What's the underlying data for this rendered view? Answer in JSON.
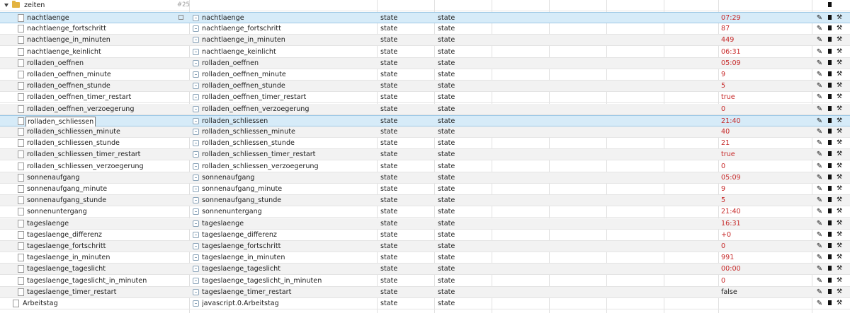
{
  "folder": {
    "name": "zeiten",
    "count": "#25"
  },
  "rows": [
    {
      "name": "nachtlaenge",
      "alias": "nachtlaenge",
      "type": "state",
      "role": "state",
      "value": "07:29",
      "vstyle": "red",
      "sel": true,
      "copy": true
    },
    {
      "name": "nachtlaenge_fortschritt",
      "alias": "nachtlaenge_fortschritt",
      "type": "state",
      "role": "state",
      "value": "87",
      "vstyle": "red"
    },
    {
      "name": "nachtlaenge_in_minuten",
      "alias": "nachtlaenge_in_minuten",
      "type": "state",
      "role": "state",
      "value": "449",
      "vstyle": "red"
    },
    {
      "name": "nachtlaenge_keinlicht",
      "alias": "nachtlaenge_keinlicht",
      "type": "state",
      "role": "state",
      "value": "06:31",
      "vstyle": "red"
    },
    {
      "name": "rolladen_oeffnen",
      "alias": "rolladen_oeffnen",
      "type": "state",
      "role": "state",
      "value": "05:09",
      "vstyle": "red"
    },
    {
      "name": "rolladen_oeffnen_minute",
      "alias": "rolladen_oeffnen_minute",
      "type": "state",
      "role": "state",
      "value": "9",
      "vstyle": "red"
    },
    {
      "name": "rolladen_oeffnen_stunde",
      "alias": "rolladen_oeffnen_stunde",
      "type": "state",
      "role": "state",
      "value": "5",
      "vstyle": "red"
    },
    {
      "name": "rolladen_oeffnen_timer_restart",
      "alias": "rolladen_oeffnen_timer_restart",
      "type": "state",
      "role": "state",
      "value": "true",
      "vstyle": "red"
    },
    {
      "name": "rolladen_oeffnen_verzoegerung",
      "alias": "rolladen_oeffnen_verzoegerung",
      "type": "state",
      "role": "state",
      "value": "0",
      "vstyle": "red"
    },
    {
      "name": "rolladen_schliessen",
      "alias": "rolladen_schliessen",
      "type": "state",
      "role": "state",
      "value": "21:40",
      "vstyle": "red",
      "sel": true,
      "box": true
    },
    {
      "name": "rolladen_schliessen_minute",
      "alias": "rolladen_schliessen_minute",
      "type": "state",
      "role": "state",
      "value": "40",
      "vstyle": "red"
    },
    {
      "name": "rolladen_schliessen_stunde",
      "alias": "rolladen_schliessen_stunde",
      "type": "state",
      "role": "state",
      "value": "21",
      "vstyle": "red"
    },
    {
      "name": "rolladen_schliessen_timer_restart",
      "alias": "rolladen_schliessen_timer_restart",
      "type": "state",
      "role": "state",
      "value": "true",
      "vstyle": "red"
    },
    {
      "name": "rolladen_schliessen_verzoegerung",
      "alias": "rolladen_schliessen_verzoegerung",
      "type": "state",
      "role": "state",
      "value": "0",
      "vstyle": "red"
    },
    {
      "name": "sonnenaufgang",
      "alias": "sonnenaufgang",
      "type": "state",
      "role": "state",
      "value": "05:09",
      "vstyle": "red"
    },
    {
      "name": "sonnenaufgang_minute",
      "alias": "sonnenaufgang_minute",
      "type": "state",
      "role": "state",
      "value": "9",
      "vstyle": "red"
    },
    {
      "name": "sonnenaufgang_stunde",
      "alias": "sonnenaufgang_stunde",
      "type": "state",
      "role": "state",
      "value": "5",
      "vstyle": "red"
    },
    {
      "name": "sonnenuntergang",
      "alias": "sonnenuntergang",
      "type": "state",
      "role": "state",
      "value": "21:40",
      "vstyle": "red"
    },
    {
      "name": "tageslaenge",
      "alias": "tageslaenge",
      "type": "state",
      "role": "state",
      "value": "16:31",
      "vstyle": "red"
    },
    {
      "name": "tageslaenge_differenz",
      "alias": "tageslaenge_differenz",
      "type": "state",
      "role": "state",
      "value": "+0",
      "vstyle": "red"
    },
    {
      "name": "tageslaenge_fortschritt",
      "alias": "tageslaenge_fortschritt",
      "type": "state",
      "role": "state",
      "value": "0",
      "vstyle": "red"
    },
    {
      "name": "tageslaenge_in_minuten",
      "alias": "tageslaenge_in_minuten",
      "type": "state",
      "role": "state",
      "value": "991",
      "vstyle": "red"
    },
    {
      "name": "tageslaenge_tageslicht",
      "alias": "tageslaenge_tageslicht",
      "type": "state",
      "role": "state",
      "value": "00:00",
      "vstyle": "red"
    },
    {
      "name": "tageslaenge_tageslicht_in_minuten",
      "alias": "tageslaenge_tageslicht_in_minuten",
      "type": "state",
      "role": "state",
      "value": "0",
      "vstyle": "red"
    },
    {
      "name": "tageslaenge_timer_restart",
      "alias": "tageslaenge_timer_restart",
      "type": "state",
      "role": "state",
      "value": "false",
      "vstyle": "plain"
    },
    {
      "name": "Arbeitstag",
      "alias": "javascript.0.Arbeitstag",
      "type": "state",
      "role": "state",
      "value": "",
      "vstyle": "plain",
      "top": true
    }
  ],
  "icons": {
    "edit": "pencil-icon",
    "delete": "trash-icon",
    "settings": "wrench-icon",
    "folder": "folder-icon",
    "file": "file-icon",
    "alias": "alias-icon",
    "copy": "copy-icon"
  },
  "colors": {
    "value": "#c62828",
    "selected": "#d6ebf8",
    "folder": "#e3b341"
  }
}
